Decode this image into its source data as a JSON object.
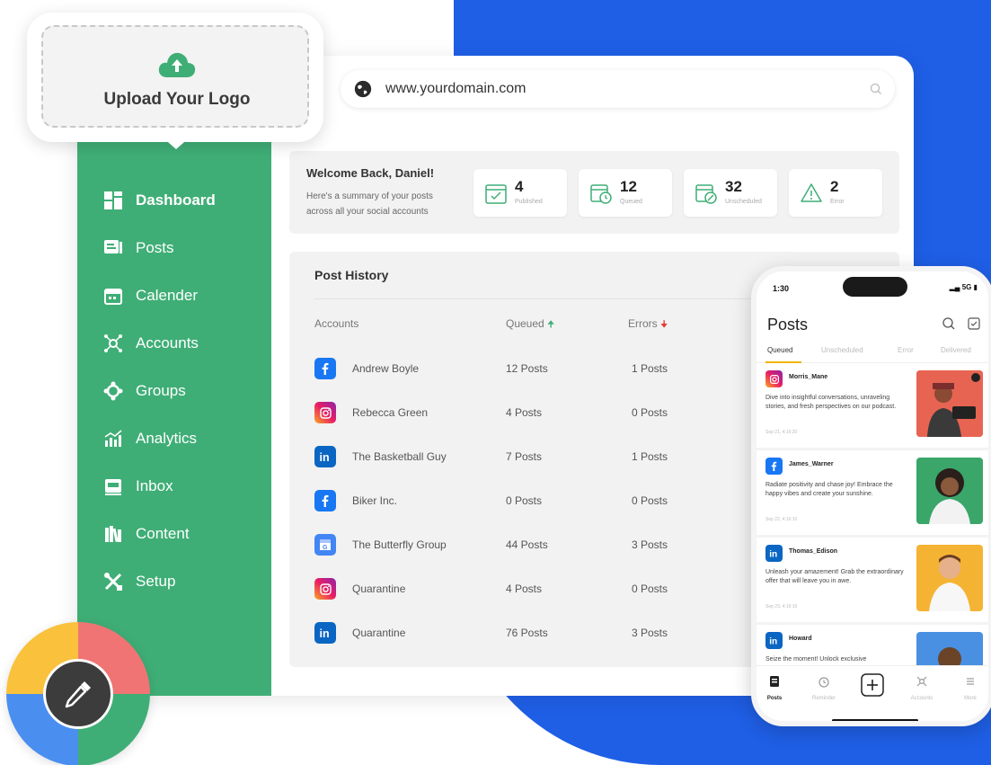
{
  "upload": {
    "label": "Upload Your Logo"
  },
  "browser": {
    "url": "www.yourdomain.com"
  },
  "sidebar": {
    "items": [
      {
        "label": "Dashboard",
        "icon": "dashboard-icon",
        "active": true
      },
      {
        "label": "Posts",
        "icon": "posts-icon"
      },
      {
        "label": "Calender",
        "icon": "calendar-icon"
      },
      {
        "label": "Accounts",
        "icon": "accounts-icon"
      },
      {
        "label": "Groups",
        "icon": "groups-icon"
      },
      {
        "label": "Analytics",
        "icon": "analytics-icon"
      },
      {
        "label": "Inbox",
        "icon": "inbox-icon"
      },
      {
        "label": "Content",
        "icon": "content-icon"
      },
      {
        "label": "Setup",
        "icon": "setup-icon"
      }
    ]
  },
  "welcome": {
    "title": "Welcome Back, Daniel!",
    "subtitle": "Here's a summary of your posts across all your social accounts"
  },
  "stats": [
    {
      "value": "4",
      "label": "Published",
      "icon": "calendar-check-icon"
    },
    {
      "value": "12",
      "label": "Queued",
      "icon": "calendar-clock-icon"
    },
    {
      "value": "32",
      "label": "Unscheduled",
      "icon": "calendar-edit-icon"
    },
    {
      "value": "2",
      "label": "Error",
      "icon": "warning-icon"
    }
  ],
  "history": {
    "title": "Post History",
    "headers": {
      "accounts": "Accounts",
      "queued": "Queued",
      "errors": "Errors"
    },
    "rows": [
      {
        "network": "facebook",
        "name": "Andrew Boyle",
        "queued": "12 Posts",
        "errors": "1 Posts"
      },
      {
        "network": "instagram",
        "name": "Rebecca Green",
        "queued": "4 Posts",
        "errors": "0 Posts"
      },
      {
        "network": "linkedin",
        "name": "The Basketball Guy",
        "queued": "7 Posts",
        "errors": "1 Posts"
      },
      {
        "network": "facebook",
        "name": "Biker Inc.",
        "queued": "0 Posts",
        "errors": "0 Posts"
      },
      {
        "network": "google-business",
        "name": "The Butterfly Group",
        "queued": "44 Posts",
        "errors": "3 Posts"
      },
      {
        "network": "instagram",
        "name": "Quarantine",
        "queued": "4 Posts",
        "errors": "0 Posts"
      },
      {
        "network": "linkedin",
        "name": "Quarantine",
        "queued": "76 Posts",
        "errors": "3 Posts"
      }
    ]
  },
  "phone": {
    "time": "1:30",
    "network": "5G",
    "title": "Posts",
    "tabs": [
      "Queued",
      "Unscheduled",
      "Error",
      "Delivered"
    ],
    "posts": [
      {
        "network": "instagram",
        "user": "Morris_Mane",
        "text": "Dive into insightful conversations, unraveling stories, and fresh perspectives on our podcast.",
        "date": "Sep 21, 4:16:20"
      },
      {
        "network": "facebook",
        "user": "James_Warner",
        "text": "Radiate positivity and chase joy! Embrace the happy vibes and create your sunshine.",
        "date": "Sep 22, 4:16:10"
      },
      {
        "network": "linkedin",
        "user": "Thomas_Edison",
        "text": "Unleash your amazement! Grab the extraordinary offer that will leave you in awe.",
        "date": "Sep 23, 4:16:10"
      },
      {
        "network": "linkedin",
        "user": "Howard",
        "text": "Seize the moment! Unlock exclusive",
        "date": ""
      }
    ],
    "nav": [
      {
        "label": "Posts",
        "icon": "posts-icon",
        "active": true
      },
      {
        "label": "Reminder",
        "icon": "alarm-icon"
      },
      {
        "label": "",
        "icon": "add-icon"
      },
      {
        "label": "Accounts",
        "icon": "accounts-icon"
      },
      {
        "label": "More",
        "icon": "menu-icon"
      }
    ]
  },
  "colors": {
    "sidebar": "#3fae76",
    "backdrop": "#1f5fe6",
    "facebook": "#1877f2",
    "linkedin": "#0a66c2",
    "queued_arrow": "#3fae76",
    "error_arrow": "#e53935"
  }
}
